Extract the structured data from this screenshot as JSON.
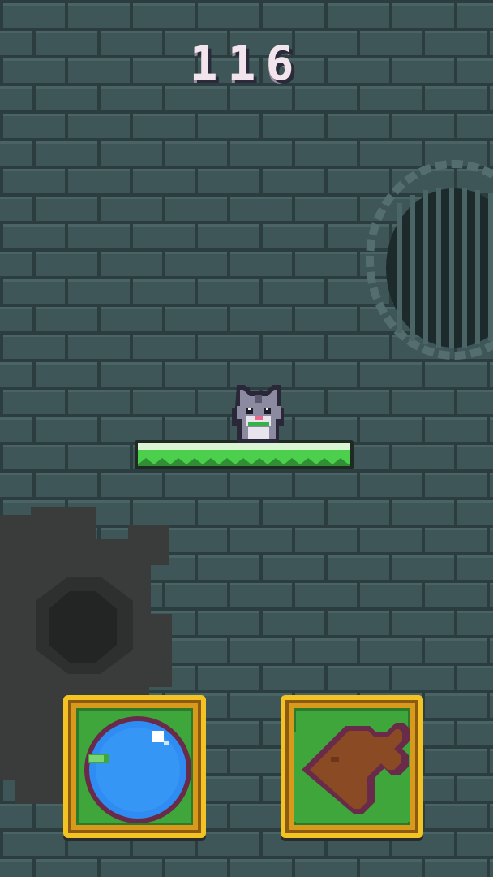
{
  "hud": {
    "score": "116"
  },
  "colors": {
    "wall": "#3e5658",
    "brick_line": "#2b3d3f",
    "platform": "#4ccf4c",
    "button_frame": "#f2c323",
    "button_fill": "#3ea63a",
    "bubble": "#2f8cf2"
  },
  "controls": {
    "left_icon": "bubble-icon",
    "right_icon": "direction-arrow-icon"
  }
}
